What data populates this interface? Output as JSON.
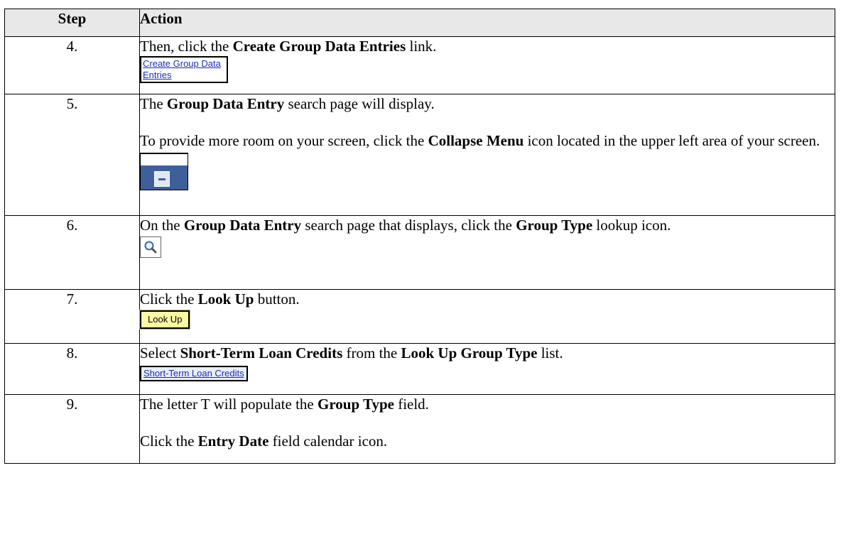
{
  "header": {
    "step": "Step",
    "action": "Action"
  },
  "rows": [
    {
      "num": "4.",
      "p1_pre": "Then, click the ",
      "p1_bold": "Create Group Data Entries",
      "p1_post": " link.",
      "widget_line1": "Create Group Data",
      "widget_line2": "Entries"
    },
    {
      "num": "5.",
      "p1_pre": "The ",
      "p1_bold": "Group Data Entry",
      "p1_post": " search page will display.",
      "p2_pre": "To provide more room on your screen, click the ",
      "p2_bold": "Collapse Menu",
      "p2_post": " icon located in the upper left area of your screen."
    },
    {
      "num": "6.",
      "p1_pre": "On the ",
      "p1_bold": "Group Data Entry",
      "p1_mid": " search page that displays, click the ",
      "p1_bold2": "Group Type",
      "p1_post": " lookup icon."
    },
    {
      "num": "7.",
      "p1_pre": "Click the ",
      "p1_bold": "Look Up",
      "p1_post": " button.",
      "widget_label": "Look Up"
    },
    {
      "num": "8.",
      "p1_pre": "Select ",
      "p1_bold": "Short-Term Loan Credits",
      "p1_mid": " from the ",
      "p1_bold2": "Look Up Group Type",
      "p1_post": " list.",
      "widget_label": "Short-Term Loan Credits"
    },
    {
      "num": "9.",
      "p1_pre": "The letter T will populate the ",
      "p1_bold": "Group Type",
      "p1_post": " field.",
      "p2_pre": "Click the ",
      "p2_bold": "Entry Date",
      "p2_post": " field calendar icon."
    }
  ],
  "icons": {
    "collapse": "collapse-menu-icon",
    "lookup": "magnifier-lookup-icon"
  },
  "colors": {
    "header_bg": "#e8e8e8",
    "link": "#1a2db8",
    "lookup_button_bg": "#fbf9a2",
    "menu_bar": "#3e5f9a"
  }
}
